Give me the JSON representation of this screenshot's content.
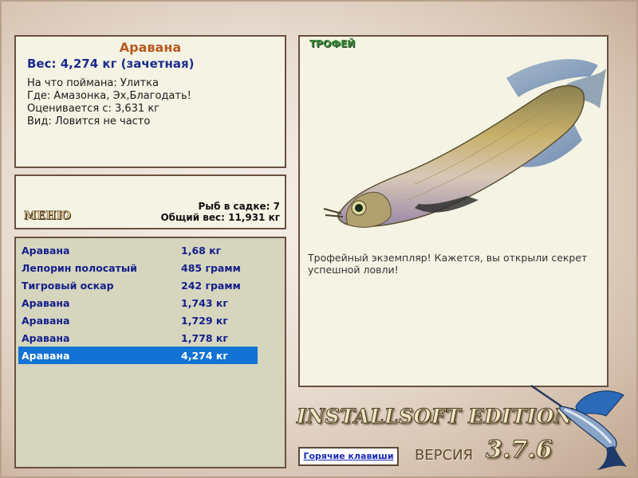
{
  "info": {
    "fish_name": "Аравана",
    "weight_line": "Вес: 4,274 кг (зачетная)",
    "caught_with": "На что поймана: Улитка",
    "location": "Где: Амазонка, Эх,Благодать!",
    "valued_from": "Оценивается с: 3,631 кг",
    "rarity": "Вид: Ловится не часто"
  },
  "menu": {
    "label": "МЕНЮ",
    "fish_count": "Рыб в садке: 7",
    "total_weight": "Общий вес: 11,931 кг"
  },
  "catch_list": [
    {
      "name": "Аравана",
      "weight": "1,68 кг"
    },
    {
      "name": "Лепорин полосатый",
      "weight": "485 грамм"
    },
    {
      "name": "Тигровый оскар",
      "weight": "242 грамм"
    },
    {
      "name": "Аравана",
      "weight": "1,743 кг"
    },
    {
      "name": "Аравана",
      "weight": "1,729 кг"
    },
    {
      "name": "Аравана",
      "weight": "1,778 кг"
    },
    {
      "name": "Аравана",
      "weight": "4,274 кг"
    }
  ],
  "selected_index": 6,
  "trophy": {
    "title": "ТРОФЕЙ",
    "text": "Трофейный экземпляр! Кажется, вы открыли секрет успешной ловли!"
  },
  "brand": "INSTALLSOFT EDITION",
  "hotkeys_label": "Горячие клавиши",
  "version_label": "ВЕРСИЯ",
  "version_number": "3.7.6",
  "colors": {
    "panel_bg": "#f5f4e4",
    "list_bg": "#d6d5be",
    "panel_border": "#6a5040",
    "fish_name": "#b85a1e",
    "weight_text": "#1c2b8c",
    "list_text": "#16208a",
    "selection": "#1273d4"
  },
  "icons": {
    "trophy_image": "arowana-fish",
    "logo": "marlin-fish"
  }
}
